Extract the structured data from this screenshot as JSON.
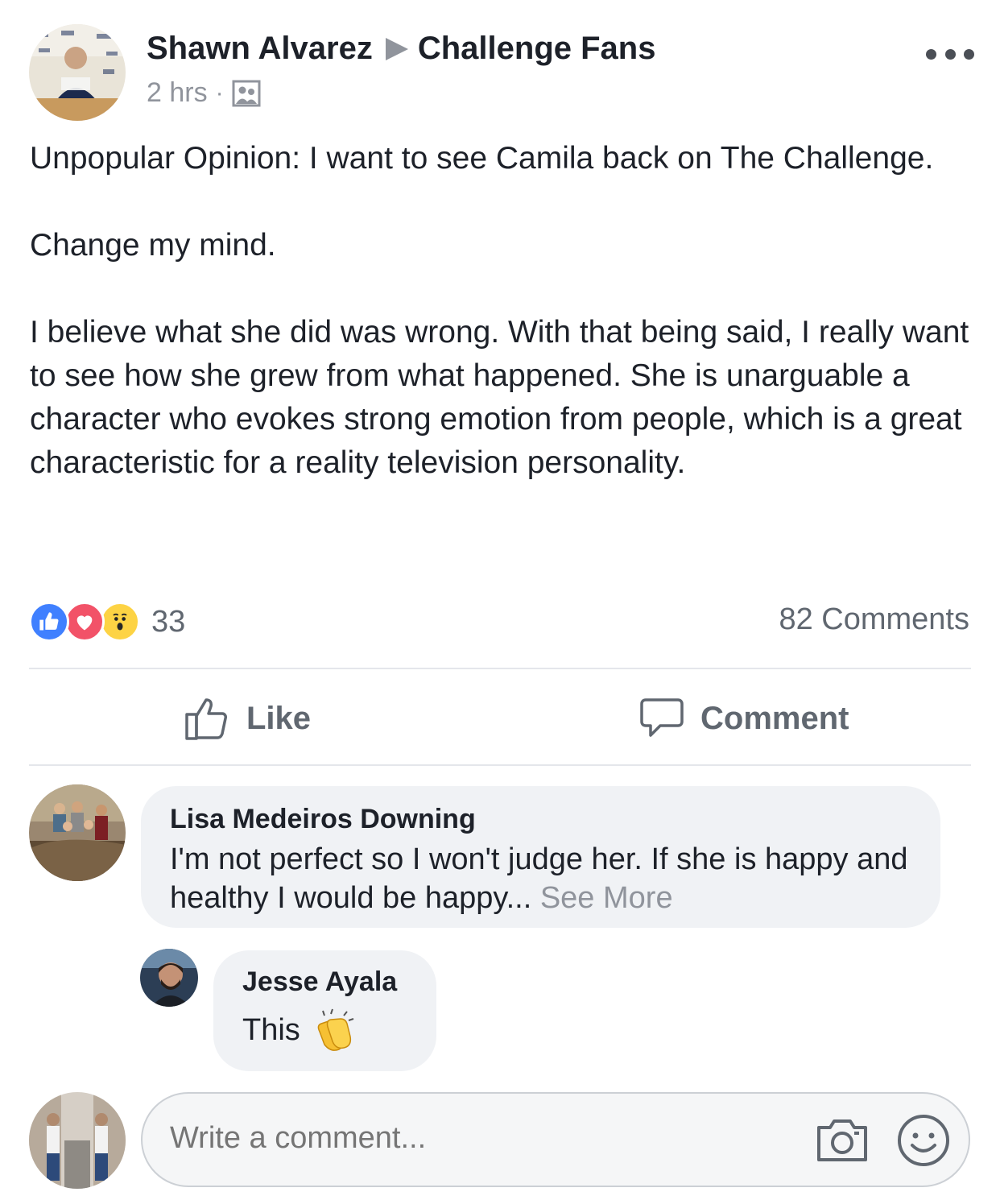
{
  "post": {
    "author": "Shawn Alvarez",
    "group": "Challenge Fans",
    "time": "2 hrs",
    "separator": "·",
    "paragraphs": [
      "Unpopular Opinion: I want to see Camila back on The Challenge.",
      "Change my mind.",
      "I believe what she did was wrong.  With that being said, I really want to see how she grew from what happened.  She is unarguable a character who evokes strong emotion from people, which is a great characteristic for a reality television personality."
    ],
    "reactions": [
      "like",
      "love",
      "wow"
    ],
    "reaction_count": "33",
    "comments_count": "82 Comments"
  },
  "actions": {
    "like_label": "Like",
    "comment_label": "Comment"
  },
  "comments": [
    {
      "author": "Lisa Medeiros Downing",
      "text": "I'm not perfect so I won't judge her. If she is happy and healthy I would be happy...",
      "see_more": "See More"
    },
    {
      "author": "Jesse Ayala",
      "text": "This",
      "emoji": "clapping-hands"
    }
  ],
  "composer": {
    "placeholder": "Write a comment..."
  },
  "colors": {
    "like_blue": "#4080ff",
    "love_red": "#f25268",
    "wow_yellow": "#fdd344",
    "muted_gray": "#90949c",
    "bubble_gray": "#f0f2f5"
  }
}
